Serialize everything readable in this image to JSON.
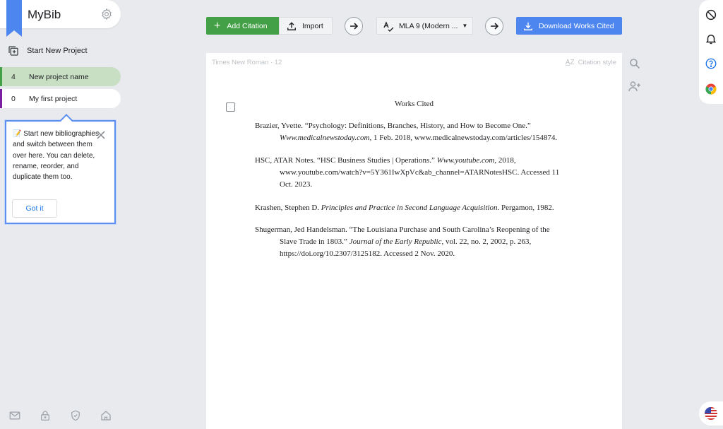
{
  "app": {
    "name": "MyBib"
  },
  "sidebar": {
    "start_project": "Start New Project",
    "projects": [
      {
        "count": "4",
        "name": "New project name",
        "color": "#43a047"
      },
      {
        "count": "0",
        "name": "My first project",
        "color": "#7b1fa2"
      }
    ],
    "tooltip": {
      "emoji": "📝",
      "text": "Start new bibliographies and switch between them over here. You can delete, rename, reorder, and duplicate them too.",
      "button": "Got it"
    },
    "bottom_icons": [
      "mail-icon",
      "lock-icon",
      "shield-icon",
      "home-icon"
    ]
  },
  "toolbar": {
    "add_citation": "Add Citation",
    "import": "Import",
    "style": "MLA 9 (Modern ...",
    "download": "Download Works Cited",
    "accent_green": "#43a047",
    "accent_blue": "#4e86f0"
  },
  "document": {
    "font_info": "Times New Roman · 12",
    "citation_style_label": "Citation style",
    "title": "Works Cited",
    "entries": [
      {
        "first": "Brazier, Yvette. “Psychology: Definitions, Branches, History, and How to Become One.”",
        "italic": "Www.medicalnewstoday.com",
        "rest": ", 1 Feb. 2018, www.medicalnewstoday.com/articles/154874."
      },
      {
        "first": "HSC, ATAR Notes. “HSC Business Studies | Operations.”",
        "italic": "Www.youtube.com",
        "rest": ", 2018,",
        "line2": "www.youtube.com/watch?v=5Y361IwXpVc&ab_channel=ATARNotesHSC. Accessed 11",
        "line3": "Oct. 2023."
      },
      {
        "prefix": "Krashen, Stephen D. ",
        "italic": "Principles and Practice in Second Language Acquisition",
        "rest": ". Pergamon, 1982."
      },
      {
        "first": "Shugerman, Jed Handelsman. “The Louisiana Purchase and South Carolina’s Reopening of the",
        "line2_prefix": "Slave Trade in 1803.” ",
        "italic": "Journal of the Early Republic",
        "rest": ", vol. 22, no. 2, 2002, p. 263,",
        "line3": "https://doi.org/10.2307/3125182. Accessed 2 Nov. 2020."
      }
    ]
  },
  "right_panel": {
    "icons": [
      "block-icon",
      "bell-icon",
      "help-icon",
      "chrome-icon"
    ],
    "flag": "us-flag-icon"
  }
}
